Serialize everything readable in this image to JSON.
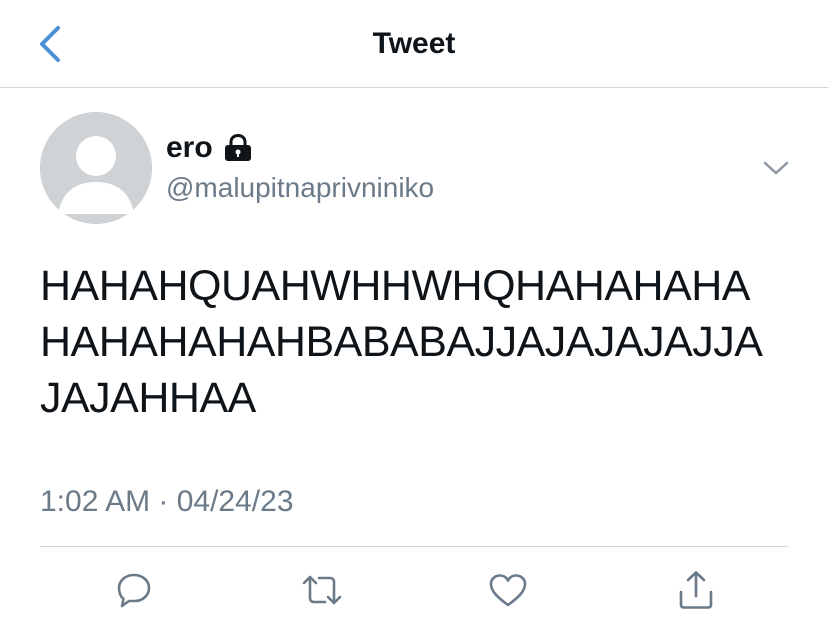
{
  "header": {
    "title": "Tweet",
    "back_icon": "chevron-left-icon",
    "accent_color": "#4a90d9"
  },
  "tweet": {
    "author": {
      "display_name": "ero",
      "handle": "@malupitnaprivniniko",
      "protected_icon": "lock-icon",
      "avatar": "default-avatar-icon"
    },
    "text_lines": [
      "HAHAHQUAHWHHWHQHAHAHAHA",
      "HAHAHAHAHBABABAJJAJAJAJAJJA",
      "JAJAHHAA"
    ],
    "timestamp": "1:02 AM · 04/24/23",
    "more_icon": "chevron-down-icon"
  },
  "actions": [
    {
      "name": "reply",
      "icon": "comment-icon"
    },
    {
      "name": "retweet",
      "icon": "retweet-icon"
    },
    {
      "name": "like",
      "icon": "heart-icon"
    },
    {
      "name": "share",
      "icon": "share-icon"
    }
  ],
  "colors": {
    "text_primary": "#0f1419",
    "text_secondary": "#6b7a89",
    "divider": "#d3d6da",
    "icon_gray": "#6b7a89"
  }
}
